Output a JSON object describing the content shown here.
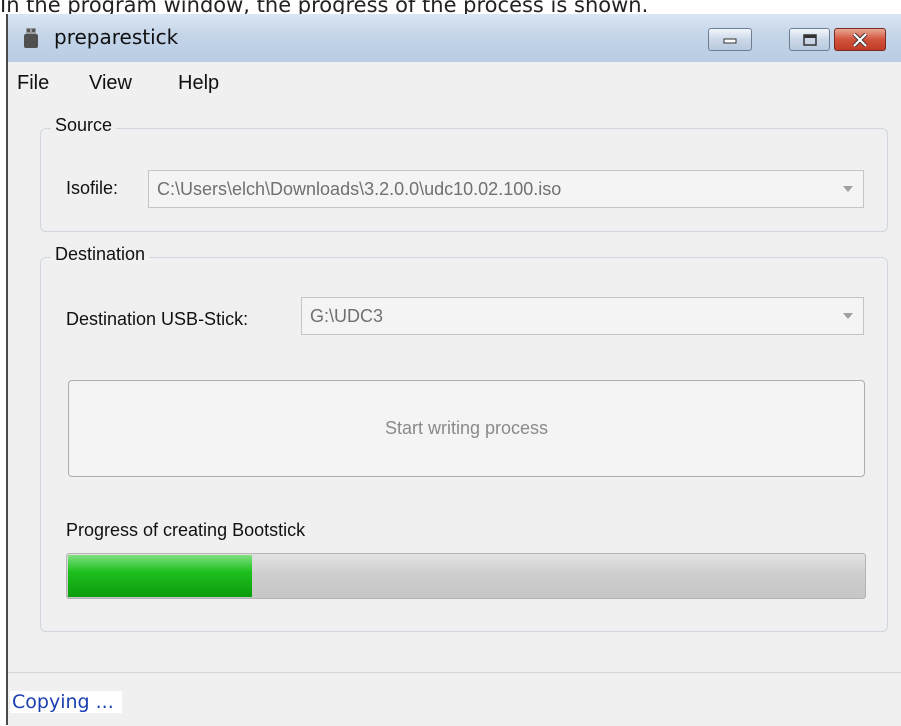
{
  "caption": "In the program window, the progress of the process is shown.",
  "window": {
    "title": "preparestick",
    "icon": "usb-stick-icon",
    "controls": [
      "minimize-icon",
      "maximize-icon",
      "close-icon"
    ]
  },
  "menu": {
    "items": [
      "File",
      "View",
      "Help"
    ]
  },
  "source": {
    "legend": "Source",
    "isofile_label": "Isofile:",
    "isofile_value": "C:\\Users\\elch\\Downloads\\3.2.0.0\\udc10.02.100.iso"
  },
  "destination": {
    "legend": "Destination",
    "usb_label": "Destination USB-Stick:",
    "usb_value": "G:\\UDC3",
    "start_button": "Start writing process"
  },
  "progress": {
    "label": "Progress of creating Bootstick",
    "fraction": 0.23,
    "fill_color": "#22c322"
  },
  "status": {
    "text": "Copying ..."
  }
}
